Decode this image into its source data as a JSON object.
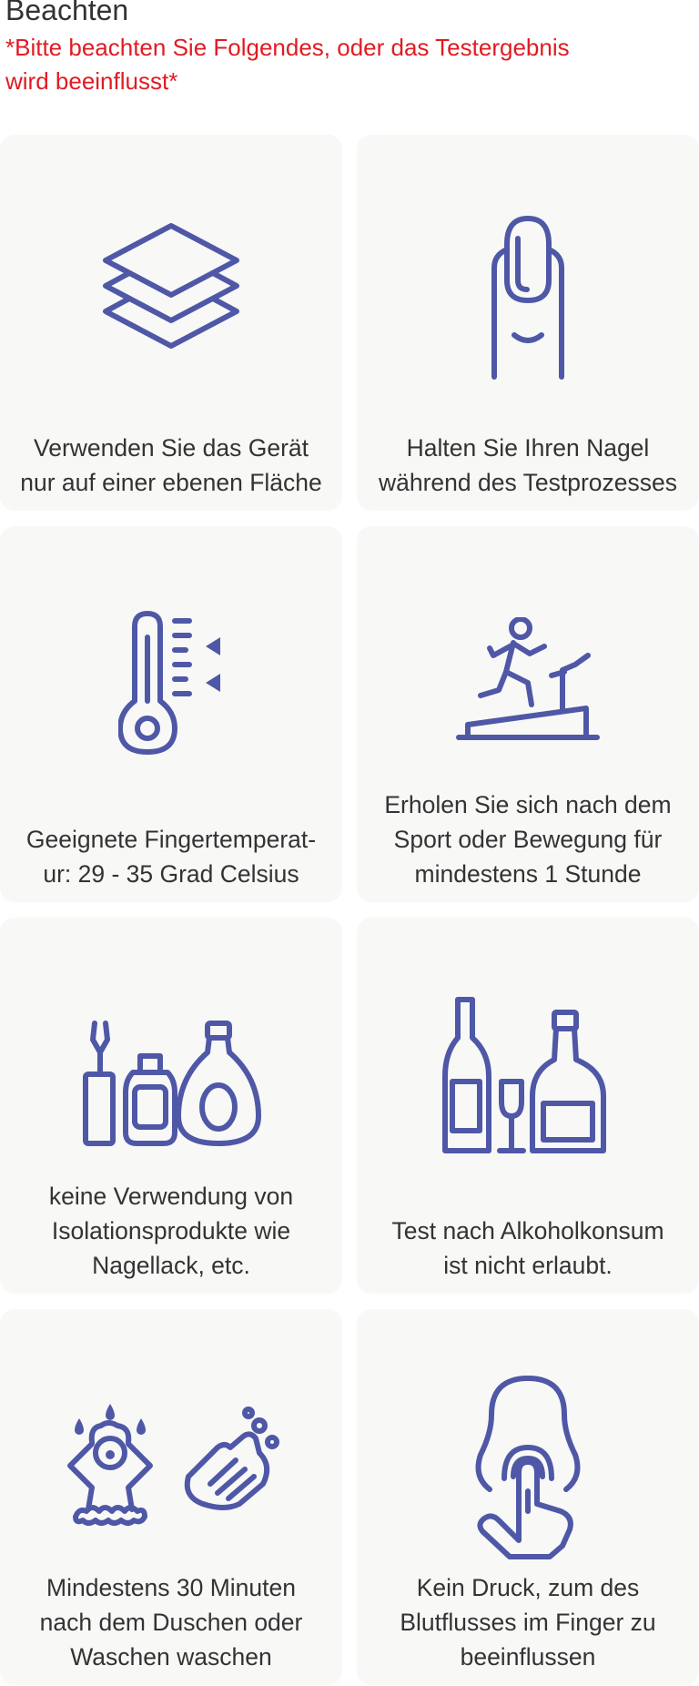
{
  "header": {
    "title": "Beachten",
    "subtitle_line1": "*Bitte beachten Sie Folgendes, oder das Testergebnis",
    "subtitle_line2": "wird beeinflusst*"
  },
  "icon_color": "#4f58a6",
  "cards": [
    {
      "icon": "layers-icon",
      "line1": "Verwenden Sie das Gerät",
      "line2": "nur auf einer ebenen Fläche"
    },
    {
      "icon": "finger-nail-icon",
      "line1": "Halten Sie Ihren Nagel",
      "line2": "während des Testprozesses"
    },
    {
      "icon": "thermometer-icon",
      "line1": "Geeignete Fingertemperat-",
      "line2": "ur:  29 - 35 Grad Celsius"
    },
    {
      "icon": "treadmill-runner-icon",
      "line1": "Erholen Sie sich nach dem",
      "line2": "Sport oder Bewegung für",
      "line3": "mindestens 1 Stunde"
    },
    {
      "icon": "nail-polish-products-icon",
      "line1": "keine Verwendung von",
      "line2": "Isolationsprodukte wie",
      "line3": "Nagellack, etc."
    },
    {
      "icon": "alcohol-bottles-icon",
      "line1": "Test nach Alkoholkonsum",
      "line2": "ist nicht erlaubt."
    },
    {
      "icon": "shower-wash-hands-icon",
      "line1": "Mindestens 30 Minuten",
      "line2": "nach dem Duschen oder",
      "line3": "Waschen waschen"
    },
    {
      "icon": "finger-press-icon",
      "line1": "Kein Druck, zum des",
      "line2": "Blutflusses im Finger zu",
      "line3": "beeinflussen"
    }
  ]
}
